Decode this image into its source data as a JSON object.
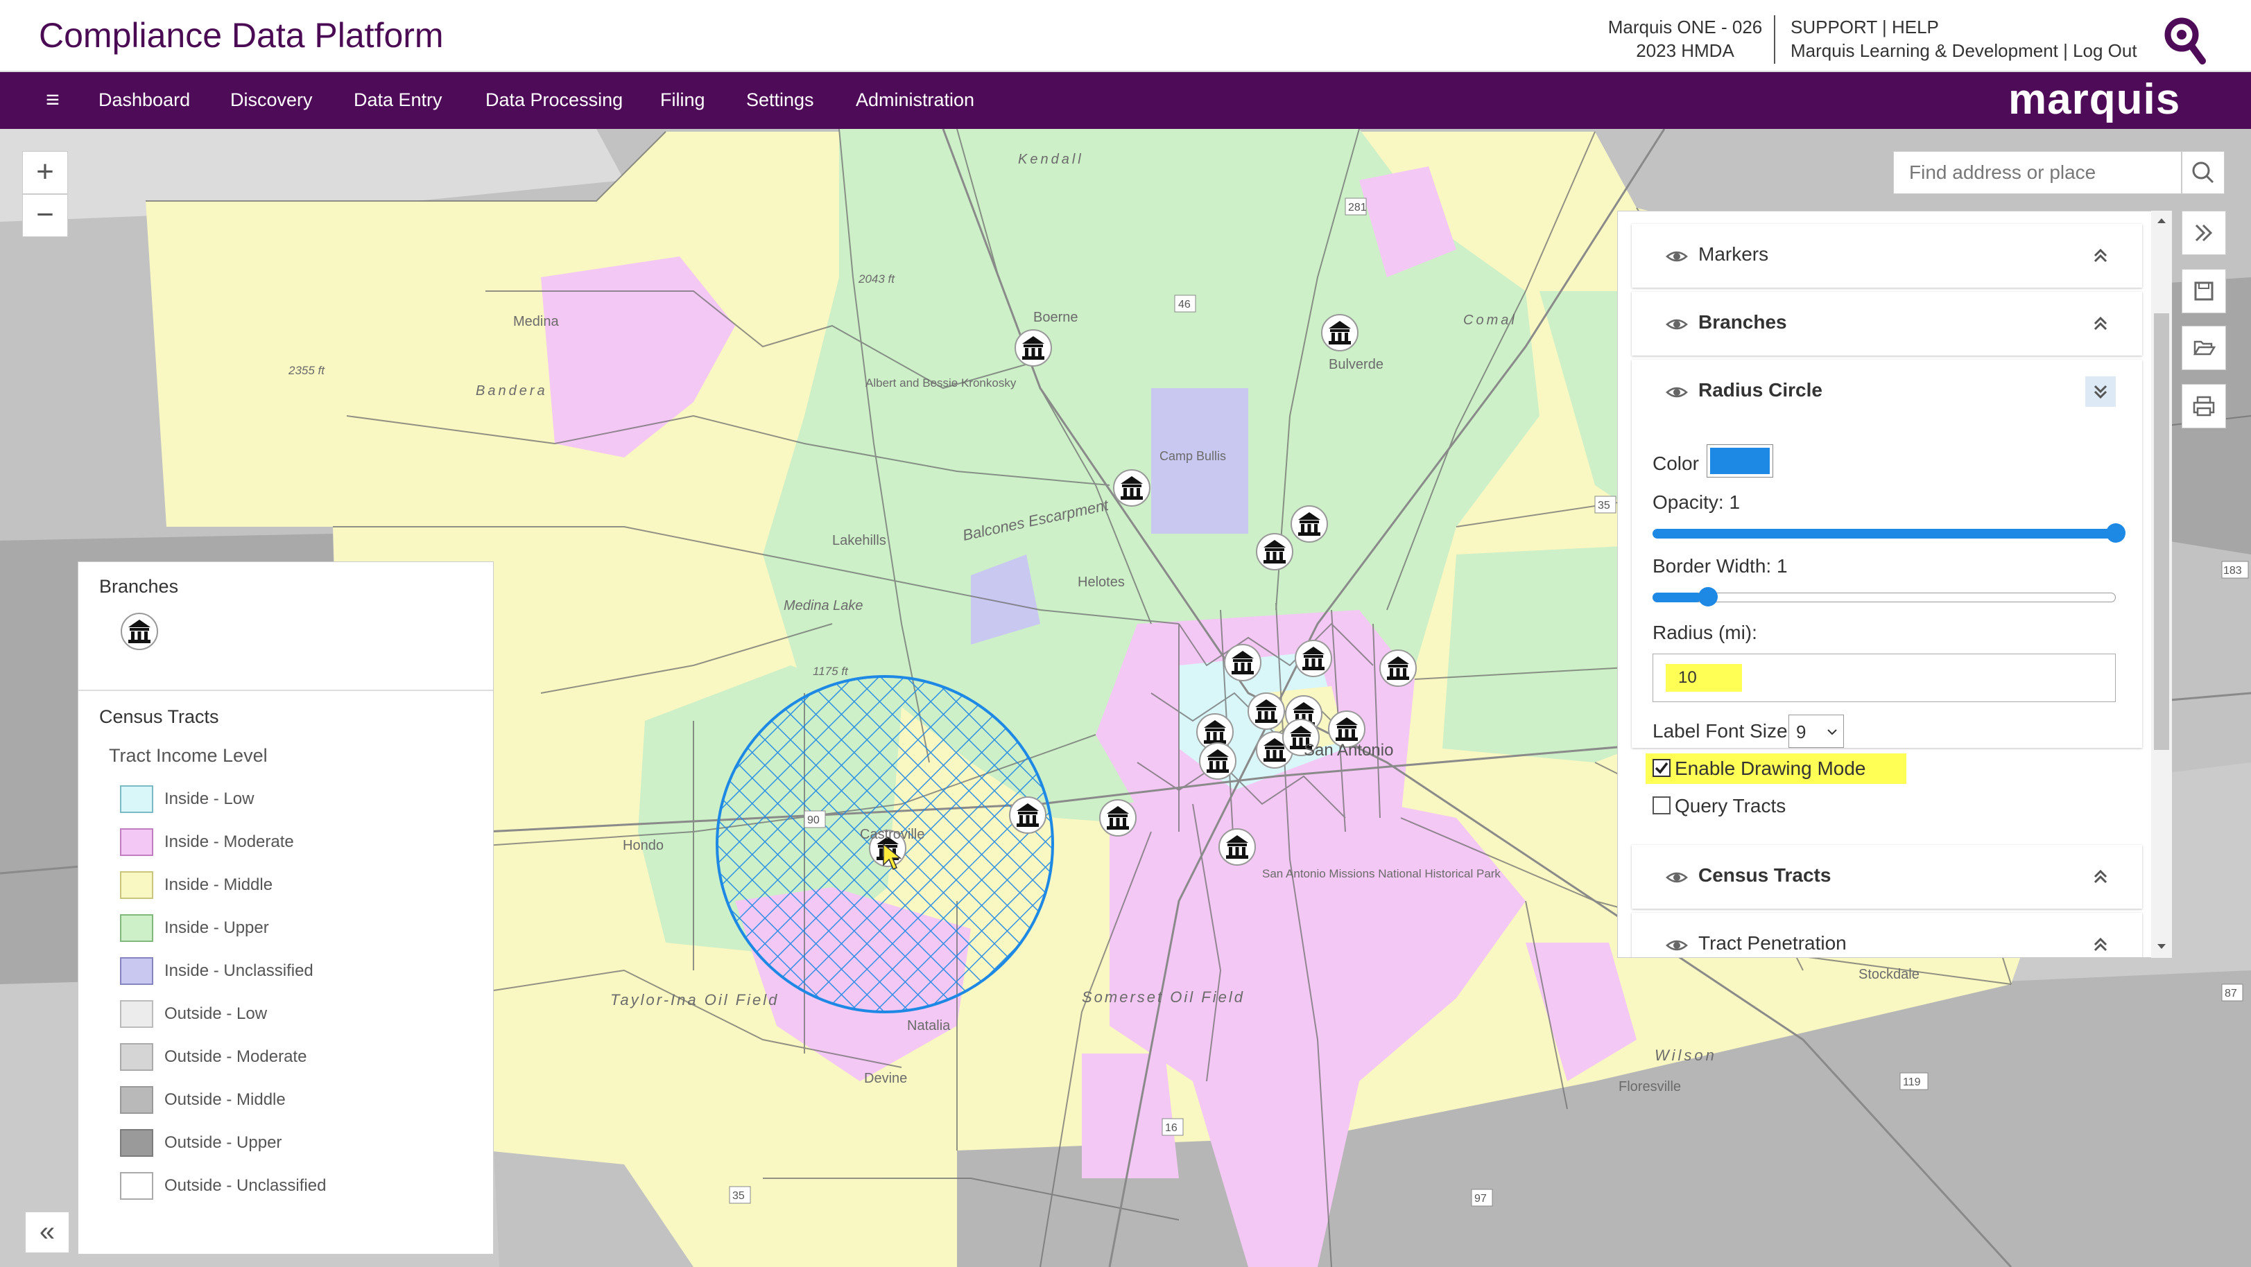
{
  "header": {
    "title": "Compliance Data Platform",
    "account_line1": "Marquis ONE - 026",
    "account_line2": "2023 HMDA",
    "links_line1": "SUPPORT | HELP",
    "links_line2": "Marquis Learning & Development | Log Out",
    "search_icon": "magnifier-icon"
  },
  "nav": {
    "menu_icon": "≡",
    "items": [
      "Dashboard",
      "Discovery",
      "Data Entry",
      "Data Processing",
      "Filing",
      "Settings",
      "Administration"
    ],
    "brand": "marquis"
  },
  "colors": {
    "brand_purple": "#4e0b57",
    "title_purple": "#4b0a54",
    "low": "#d9f6f8",
    "moderate": "#f4c8f4",
    "middle": "#f9f7c2",
    "upper": "#cdf0c8",
    "unclassified": "#c9c8f0",
    "radius_circle": "#1e88e5",
    "highlight": "#ffff55"
  },
  "map": {
    "zoom_in": "+",
    "zoom_out": "−",
    "search_placeholder": "Find address or place",
    "place_labels": [
      "Medina",
      "Bandera",
      "Boerne",
      "Bulverde",
      "Kendall",
      "Comal",
      "Albert and Bessie Kronkosky",
      "Camp Bullis",
      "Balcones Escarpment",
      "Lakehills",
      "Helotes",
      "Castroville",
      "Hondo",
      "Medina Lake",
      "San Antonio",
      "San Antonio Missions National Historical Park",
      "Taylor-Ina Oil Field",
      "Natalia",
      "Devine",
      "Somerset Oil Field",
      "Floresville",
      "Wilson",
      "Stockdale",
      "2043 ft",
      "2355 ft",
      "1175 ft"
    ],
    "road_labels": [
      "281",
      "46",
      "35",
      "183",
      "87",
      "119",
      "97",
      "16",
      "35",
      "90"
    ]
  },
  "panel": {
    "sections_top": [
      {
        "label": "Markers",
        "chevron": "collapse"
      },
      {
        "label": "Branches",
        "chevron": "collapse"
      },
      {
        "label": "Radius Circle",
        "chevron": "expand"
      }
    ],
    "color_label": "Color",
    "color_value": "#1e88e5",
    "opacity_label": "Opacity: 1",
    "opacity_value": 1,
    "border_label": "Border Width: 1",
    "border_value": 1,
    "radius_label": "Radius (mi):",
    "radius_value": "10",
    "font_size_label": "Label Font Size",
    "font_size_value": "9",
    "drawing_mode_label": "Enable Drawing Mode",
    "drawing_mode_checked": true,
    "query_tracts_label": "Query Tracts",
    "query_tracts_checked": false,
    "sections_bottom": [
      {
        "label": "Census Tracts",
        "chevron": "collapse"
      },
      {
        "label": "Tract Penetration",
        "chevron": "collapse"
      }
    ]
  },
  "tools": [
    "double-chevron-right-icon",
    "save-icon",
    "folder-open-icon",
    "print-icon"
  ],
  "legend": {
    "branches_title": "Branches",
    "census_title": "Census Tracts",
    "income_title": "Tract Income Level",
    "items": [
      {
        "label": "Inside - Low",
        "color": "#d9f6f8",
        "border": "#7bb9c4"
      },
      {
        "label": "Inside - Moderate",
        "color": "#f4c8f4",
        "border": "#c07ec0"
      },
      {
        "label": "Inside - Middle",
        "color": "#f9f7c2",
        "border": "#c9c47e"
      },
      {
        "label": "Inside - Upper",
        "color": "#cdf0c8",
        "border": "#82b87c"
      },
      {
        "label": "Inside - Unclassified",
        "color": "#c9c8f0",
        "border": "#8584c0"
      },
      {
        "label": "Outside - Low",
        "color": "#ececec",
        "border": "#bbbbbb"
      },
      {
        "label": "Outside - Moderate",
        "color": "#d5d5d5",
        "border": "#aaaaaa"
      },
      {
        "label": "Outside - Middle",
        "color": "#b9b9b9",
        "border": "#999999"
      },
      {
        "label": "Outside - Upper",
        "color": "#9a9a9a",
        "border": "#7c7c7c"
      },
      {
        "label": "Outside - Unclassified",
        "color": "#ffffff",
        "border": "#aaaaaa"
      }
    ],
    "collapse_label": "«"
  }
}
